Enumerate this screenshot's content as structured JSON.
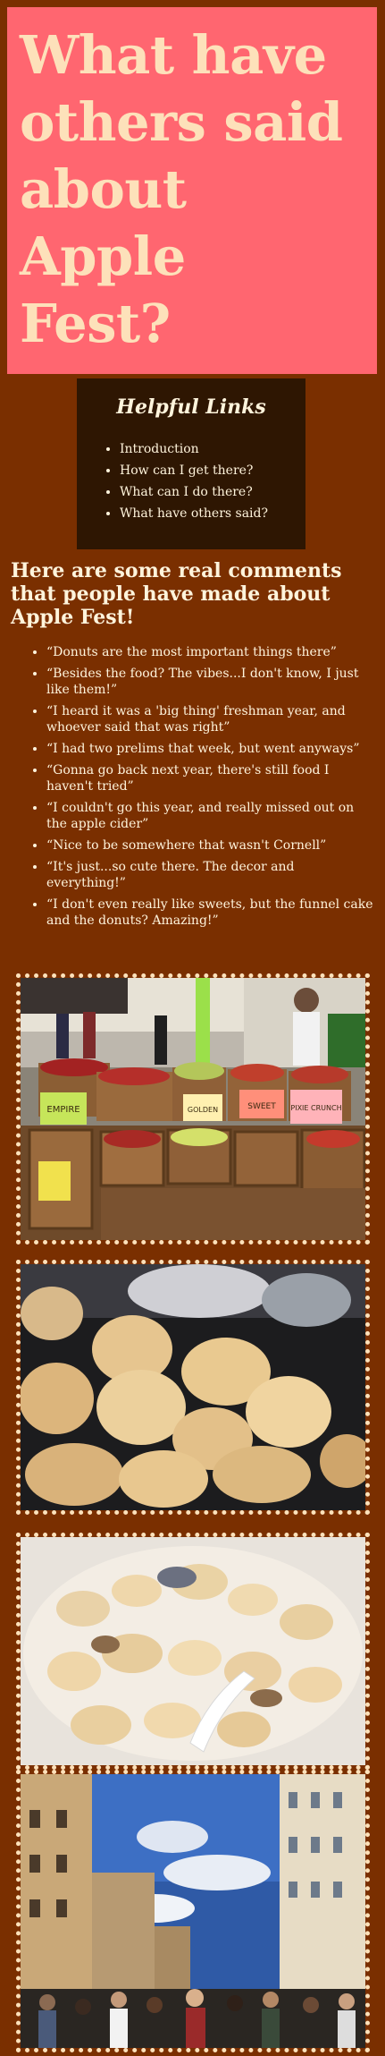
{
  "hero": {
    "title_line1": "What have",
    "title_line2": "others said",
    "title_line3": "about",
    "title_line4": "Apple",
    "title_line5": "Fest?"
  },
  "helpful_links": {
    "heading": "Helpful Links",
    "items": [
      {
        "label": "Introduction"
      },
      {
        "label": "How can I get there?"
      },
      {
        "label": "What can I do there?"
      },
      {
        "label": "What have others said?"
      }
    ]
  },
  "comments_section": {
    "heading": "Here are some real comments that people have made about Apple Fest!",
    "items": [
      "“Donuts are the most important things there”",
      "“Besides the food? The vibes...I don't know, I just like them!”",
      "“I heard it was a 'big thing' freshman year, and whoever said that was right”",
      "“I had two prelims that week, but went anyways”",
      "“Gonna go back next year, there's still food I haven't tried”",
      "“I couldn't go this year, and really missed out on the apple cider”",
      "“Nice to be somewhere that wasn't Cornell”",
      "“It's just...so cute there. The decor and everything!”",
      "“I don't even really like sweets, but the funnel cake and the donuts? Amazing!”"
    ]
  },
  "photos": {
    "photo1": {
      "sign_empire": "EMPIRE",
      "sign_gold": "GOLDEN",
      "sign_sweet": "SWEET",
      "sign_pixie": "PIXIE CRUNCH"
    }
  },
  "colors": {
    "page_background": "#7a2f00",
    "hero_background": "#ff6670",
    "hero_text": "#fde1ba",
    "links_box_background": "#2e1602",
    "text": "#fff4dc",
    "frame_border": "#fde1ba"
  }
}
